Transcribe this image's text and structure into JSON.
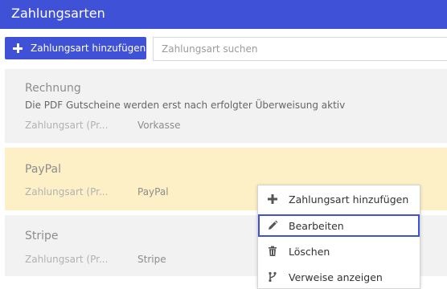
{
  "header": {
    "title": "Zahlungsarten"
  },
  "toolbar": {
    "add_label": "Zahlungsart hinzufügen",
    "search_placeholder": "Zahlungsart suchen"
  },
  "cards": [
    {
      "name": "Rechnung",
      "description": "Die PDF Gutscheine werden erst nach erfolgter Überweisung aktiv",
      "field_label": "Zahlungsart (Pr...",
      "field_value": "Vorkasse"
    },
    {
      "name": "PayPal",
      "field_label": "Zahlungsart (Pr...",
      "field_value": "PayPal",
      "highlighted": true
    },
    {
      "name": "Stripe",
      "field_label": "Zahlungsart (Pr...",
      "field_value": "Stripe"
    }
  ],
  "context_menu": {
    "items": [
      {
        "label": "Zahlungsart hinzufügen",
        "icon": "plus-icon"
      },
      {
        "label": "Bearbeiten",
        "icon": "pencil-icon",
        "active": true
      },
      {
        "label": "Löschen",
        "icon": "trash-icon"
      },
      {
        "label": "Verweise anzeigen",
        "icon": "branch-icon"
      }
    ]
  },
  "colors": {
    "accent": "#3f51d6",
    "card_background": "#f2f2f2",
    "highlight_background": "#fdf0c6"
  }
}
